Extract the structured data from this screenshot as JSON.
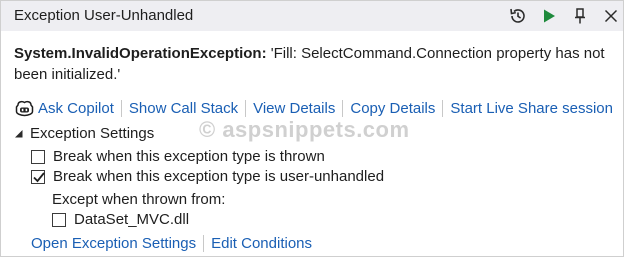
{
  "window": {
    "title": "Exception User-Unhandled"
  },
  "titlebar_icons": [
    "history-icon",
    "continue-play-icon",
    "pin-icon",
    "close-icon"
  ],
  "exception": {
    "type": "System.InvalidOperationException:",
    "message": " 'Fill: SelectCommand.Connection property has not been initialized.'"
  },
  "actions": {
    "ask_copilot": "Ask Copilot",
    "show_call_stack": "Show Call Stack",
    "view_details": "View Details",
    "copy_details": "Copy Details",
    "live_share": "Start Live Share session"
  },
  "settings": {
    "header": "Exception Settings",
    "break_thrown": {
      "label": "Break when this exception type is thrown",
      "checked": false
    },
    "break_unhandled": {
      "label": "Break when this exception type is user-unhandled",
      "checked": true
    },
    "except_label": "Except when thrown from:",
    "module": {
      "label": "DataSet_MVC.dll",
      "checked": false
    }
  },
  "footer": {
    "open_settings": "Open Exception Settings",
    "edit_conditions": "Edit Conditions"
  },
  "watermark": "© aspsnippets.com",
  "colors": {
    "link": "#1a5fb4",
    "play": "#1e8a3c",
    "titlebar": "#eeeef2"
  }
}
